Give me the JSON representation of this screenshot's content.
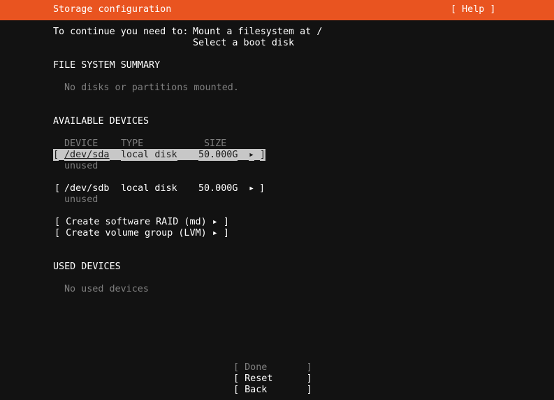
{
  "header": {
    "title": "Storage configuration",
    "help": "[ Help ]"
  },
  "requirements": {
    "prefix": "To continue you need to:",
    "items": [
      "Mount a filesystem at /",
      "Select a boot disk"
    ]
  },
  "fs_summary": {
    "heading": "FILE SYSTEM SUMMARY",
    "empty": "No disks or partitions mounted."
  },
  "available": {
    "heading": "AVAILABLE DEVICES",
    "columns": {
      "device": "DEVICE",
      "type": "TYPE",
      "size": "SIZE"
    },
    "devices": [
      {
        "open": "[",
        "name": "/dev/sda",
        "type": "local disk",
        "size": "50.000G",
        "arrow": "▸",
        "close": "]",
        "sub": "unused"
      },
      {
        "open": "[",
        "name": "/dev/sdb",
        "type": "local disk",
        "size": "50.000G",
        "arrow": "▸",
        "close": "]",
        "sub": "unused"
      }
    ],
    "actions": [
      "[ Create software RAID (md) ▸ ]",
      "[ Create volume group (LVM) ▸ ]"
    ]
  },
  "used": {
    "heading": "USED DEVICES",
    "empty": "No used devices"
  },
  "footer": {
    "done": "[ Done       ]",
    "reset": "[ Reset      ]",
    "back": "[ Back       ]"
  },
  "colors": {
    "header_bg": "#e95420",
    "background": "#121212",
    "selection_bg": "#c7c7c7"
  }
}
